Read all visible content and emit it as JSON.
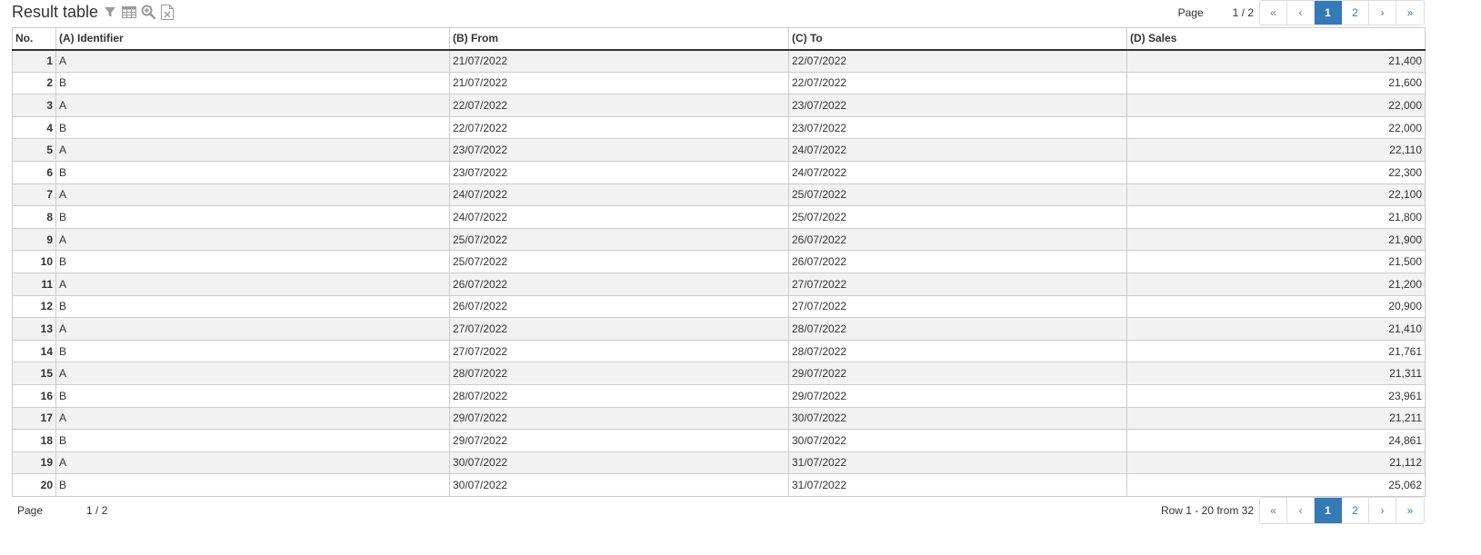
{
  "header": {
    "title": "Result table",
    "icons": [
      "filter-icon",
      "table-icon",
      "zoom-icon",
      "excel-icon"
    ]
  },
  "pager": {
    "page_label": "Page",
    "page_count": "1 / 2",
    "first": "«",
    "prev": "‹",
    "pages": [
      "1",
      "2"
    ],
    "active_page": "1",
    "next": "›",
    "last": "»"
  },
  "table": {
    "columns": [
      "No.",
      "(A) Identifier",
      "(B) From",
      "(C) To",
      "(D) Sales"
    ],
    "rows": [
      [
        "1",
        "A",
        "21/07/2022",
        "22/07/2022",
        "21,400"
      ],
      [
        "2",
        "B",
        "21/07/2022",
        "22/07/2022",
        "21,600"
      ],
      [
        "3",
        "A",
        "22/07/2022",
        "23/07/2022",
        "22,000"
      ],
      [
        "4",
        "B",
        "22/07/2022",
        "23/07/2022",
        "22,000"
      ],
      [
        "5",
        "A",
        "23/07/2022",
        "24/07/2022",
        "22,110"
      ],
      [
        "6",
        "B",
        "23/07/2022",
        "24/07/2022",
        "22,300"
      ],
      [
        "7",
        "A",
        "24/07/2022",
        "25/07/2022",
        "22,100"
      ],
      [
        "8",
        "B",
        "24/07/2022",
        "25/07/2022",
        "21,800"
      ],
      [
        "9",
        "A",
        "25/07/2022",
        "26/07/2022",
        "21,900"
      ],
      [
        "10",
        "B",
        "25/07/2022",
        "26/07/2022",
        "21,500"
      ],
      [
        "11",
        "A",
        "26/07/2022",
        "27/07/2022",
        "21,200"
      ],
      [
        "12",
        "B",
        "26/07/2022",
        "27/07/2022",
        "20,900"
      ],
      [
        "13",
        "A",
        "27/07/2022",
        "28/07/2022",
        "21,410"
      ],
      [
        "14",
        "B",
        "27/07/2022",
        "28/07/2022",
        "21,761"
      ],
      [
        "15",
        "A",
        "28/07/2022",
        "29/07/2022",
        "21,311"
      ],
      [
        "16",
        "B",
        "28/07/2022",
        "29/07/2022",
        "23,961"
      ],
      [
        "17",
        "A",
        "29/07/2022",
        "30/07/2022",
        "21,211"
      ],
      [
        "18",
        "B",
        "29/07/2022",
        "30/07/2022",
        "24,861"
      ],
      [
        "19",
        "A",
        "30/07/2022",
        "31/07/2022",
        "21,112"
      ],
      [
        "20",
        "B",
        "30/07/2022",
        "31/07/2022",
        "25,062"
      ]
    ]
  },
  "footer": {
    "page_label": "Page",
    "page_count": "1 / 2",
    "rows_text": "Row 1 - 20 from 32"
  },
  "colors": {
    "accent": "#337ab7",
    "row_stripe": "#f2f2f2",
    "border": "#cccccc",
    "icon_gray": "#9a9a9a"
  }
}
